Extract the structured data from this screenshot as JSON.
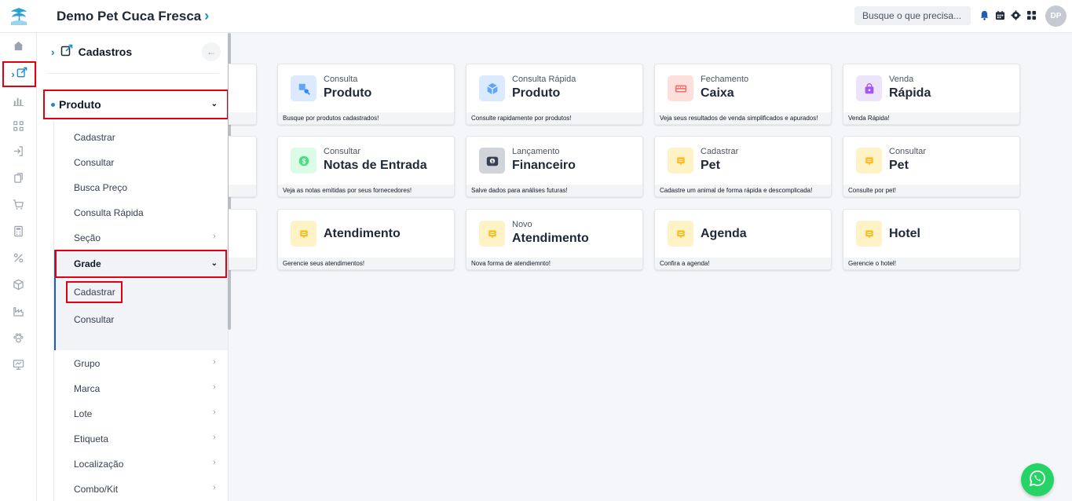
{
  "app": {
    "company_name": "Demo Pet Cuca Fresca"
  },
  "search": {
    "placeholder": "Busque o que precisa..."
  },
  "user": {
    "initials": "DP"
  },
  "top_icons": [
    "notification-bell-icon",
    "calendar-icon",
    "settings-icon",
    "apps-grid-icon"
  ],
  "rail": {
    "items": [
      "home-icon",
      "edit-register-icon",
      "bar-chart-icon",
      "scan-icon",
      "login-icon",
      "copy-icon",
      "cart-icon",
      "calculator-icon",
      "percent-icon",
      "box-icon",
      "factory-icon",
      "paw-icon",
      "presentation-icon"
    ],
    "active": "edit-register-icon"
  },
  "panel": {
    "title": "Cadastros",
    "section": "Produto",
    "items": {
      "cadastrar": "Cadastrar",
      "consultar": "Consultar",
      "busca_preco": "Busca Preço",
      "consulta_rapida": "Consulta Rápida",
      "secao": "Seção",
      "grade": "Grade",
      "grade_cadastrar": "Cadastrar",
      "grade_consultar": "Consultar",
      "grupo": "Grupo",
      "marca": "Marca",
      "lote": "Lote",
      "etiqueta": "Etiqueta",
      "localizacao": "Localização",
      "combo_kit": "Combo/Kit"
    }
  },
  "cards": [
    {
      "sub": "Consulta",
      "title": "Produto",
      "footer": "Busque por produtos cadastrados!",
      "icon": "product-search-icon",
      "color": "#dbeafe"
    },
    {
      "sub": "Consulta Rápida",
      "title": "Produto",
      "footer": "Consulte rapidamente por produtos!",
      "icon": "fast-box-icon",
      "color": "#dbeafe"
    },
    {
      "sub": "Fechamento",
      "title": "Caixa",
      "footer": "Veja seus resultados de venda simplificados e apurados!",
      "icon": "cash-register-icon",
      "color": "#fde0dc"
    },
    {
      "sub": "Venda",
      "title": "Rápida",
      "footer": "Venda Rápida!",
      "icon": "shopping-bag-icon",
      "color": "#ede4fb"
    },
    {
      "sub": "Consultar",
      "title": "Notas de Entrada",
      "footer": "Veja as notas emitidas por seus fornecedores!",
      "icon": "money-icon",
      "color": "#dcfce7"
    },
    {
      "sub": "Lançamento",
      "title": "Financeiro",
      "footer": "Salve dados para análises futuras!",
      "icon": "wallet-icon",
      "color": "#d1d5db"
    },
    {
      "sub": "Cadastrar",
      "title": "Pet",
      "footer": "Cadastre um animal de forma rápida e descomplicada!",
      "icon": "note-icon",
      "color": "#fef3c7"
    },
    {
      "sub": "Consultar",
      "title": "Pet",
      "footer": "Consulte por pet!",
      "icon": "note-icon",
      "color": "#fef3c7"
    },
    {
      "sub": "",
      "title": "Atendimento",
      "footer": "Gerencie seus atendimentos!",
      "icon": "note-icon",
      "color": "#fef3c7"
    },
    {
      "sub": "Novo",
      "title": "Atendimento",
      "footer": "Nova forma de atendiemnto!",
      "icon": "note-icon",
      "color": "#fef3c7"
    },
    {
      "sub": "",
      "title": "Agenda",
      "footer": "Confira a agenda!",
      "icon": "note-icon",
      "color": "#fef3c7"
    },
    {
      "sub": "",
      "title": "Hotel",
      "footer": "Gerencie o hotel!",
      "icon": "note-icon",
      "color": "#fef3c7"
    }
  ],
  "colors": {
    "accent": "#1e88c8",
    "highlight": "#e3000f",
    "whatsapp": "#25d366"
  }
}
